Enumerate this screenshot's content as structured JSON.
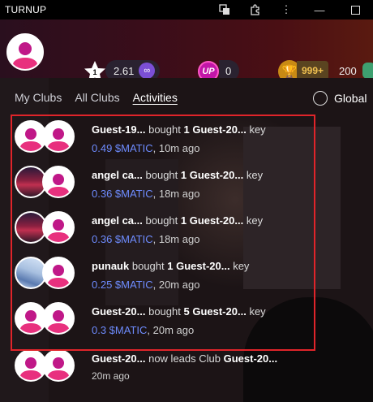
{
  "window": {
    "title": "TURNUP"
  },
  "titlebar_icons": [
    "translate-icon",
    "extension-icon",
    "more-vert-icon",
    "minimize-icon",
    "maximize-icon"
  ],
  "stats": {
    "matic_balance": "2.61",
    "up_count": "0",
    "gold_value": "999+",
    "points": "200"
  },
  "tabs": [
    {
      "label": "My Clubs",
      "active": false
    },
    {
      "label": "All Clubs",
      "active": false
    },
    {
      "label": "Activities",
      "active": true
    }
  ],
  "global_label": "Global",
  "activities": [
    {
      "actor": "Guest-19...",
      "verb": "bought",
      "qty": "1",
      "target": "Guest-20...",
      "tail": "key",
      "price": "0.49 $MATIC",
      "time": ", 10m ago"
    },
    {
      "actor": "angel ca...",
      "verb": "bought",
      "qty": "1",
      "target": "Guest-20...",
      "tail": "key",
      "price": "0.36 $MATIC",
      "time": ", 18m ago"
    },
    {
      "actor": "angel ca...",
      "verb": "bought",
      "qty": "1",
      "target": "Guest-20...",
      "tail": "key",
      "price": "0.36 $MATIC",
      "time": ", 18m ago"
    },
    {
      "actor": "punauk",
      "verb": "bought",
      "qty": "1",
      "target": "Guest-20...",
      "tail": "key",
      "price": "0.25 $MATIC",
      "time": ", 20m ago"
    },
    {
      "actor": "Guest-20...",
      "verb": "bought",
      "qty": "5",
      "target": "Guest-20...",
      "tail": "key",
      "price": "0.3 $MATIC",
      "time": ", 20m ago"
    },
    {
      "actor": "Guest-20...",
      "verb": "now leads Club",
      "qty": "",
      "target": "Guest-20...",
      "tail": "",
      "price": "",
      "time": "20m ago"
    }
  ],
  "colors": {
    "accent_blue": "#6e8cff",
    "highlight_red": "#e0242a",
    "matic_purple": "#7b4fd6",
    "up_pink": "#c216a8",
    "gold": "#f0c050"
  }
}
